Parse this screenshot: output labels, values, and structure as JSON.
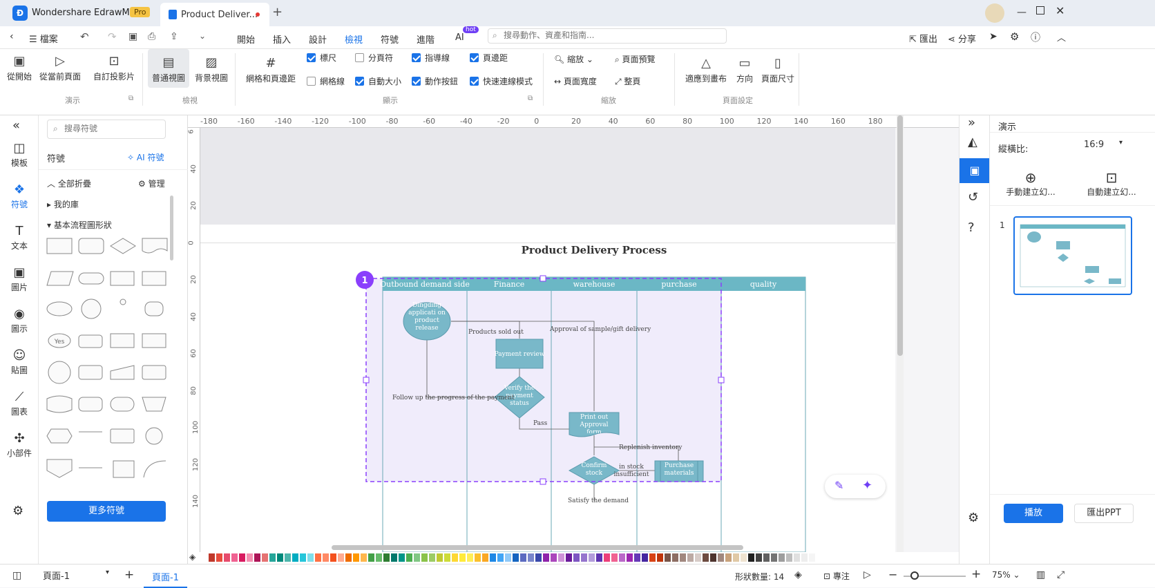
{
  "titlebar": {
    "app_name": "Wondershare EdrawMax",
    "pro_badge": "Pro",
    "doc_tab": "Product Deliver...",
    "new_tab": "+"
  },
  "menubar": {
    "file": "檔案",
    "tabs": [
      "開始",
      "插入",
      "設計",
      "檢視",
      "符號",
      "進階",
      "AI"
    ],
    "active_tab": "檢視",
    "ai_badge": "hot",
    "search_placeholder": "搜尋動作、資產和指南...",
    "export": "匯出",
    "share": "分享"
  },
  "ribbon": {
    "present": {
      "items": [
        "從開始",
        "從當前頁面",
        "自訂投影片"
      ],
      "label": "演示"
    },
    "view": {
      "items": [
        "普通視圖",
        "背景視圖"
      ],
      "label": "檢視"
    },
    "grid_btn": "網格和頁邊距",
    "display": {
      "checks": [
        {
          "label": "標尺",
          "on": true
        },
        {
          "label": "分頁符",
          "on": false
        },
        {
          "label": "指導線",
          "on": true
        },
        {
          "label": "頁邊距",
          "on": true
        },
        {
          "label": "網格線",
          "on": false
        },
        {
          "label": "自動大小",
          "on": true
        },
        {
          "label": "動作按鈕",
          "on": true
        },
        {
          "label": "快速連線模式",
          "on": true
        }
      ],
      "label": "顯示"
    },
    "zoom": {
      "items": [
        "縮放",
        "頁面預覽",
        "頁面寬度",
        "整頁"
      ],
      "label": "縮放"
    },
    "page_setup": {
      "items": [
        "適應到畫布",
        "方向",
        "頁面尺寸"
      ],
      "label": "頁面設定"
    }
  },
  "leftnav": {
    "items": [
      "模板",
      "符號",
      "文本",
      "圖片",
      "圖示",
      "貼圖",
      "圖表",
      "小部件"
    ]
  },
  "library": {
    "search_placeholder": "搜尋符號",
    "title": "符號",
    "ai_symbol": "AI 符號",
    "collapse_all": "全部折疊",
    "manage": "管理",
    "my_library": "我的庫",
    "basic_flow": "基本流程圖形狀",
    "more_symbols": "更多符號",
    "yes_label": "Yes"
  },
  "ruler": {
    "h": [
      "-180",
      "-160",
      "-140",
      "-120",
      "-100",
      "-80",
      "-60",
      "-40",
      "-20",
      "0",
      "20",
      "40",
      "60",
      "80",
      "100",
      "120",
      "140",
      "160",
      "180"
    ],
    "v": [
      "6",
      "40",
      "20",
      "0",
      "20",
      "40",
      "60",
      "80",
      "100",
      "120",
      "140"
    ]
  },
  "diagram": {
    "title": "Product Delivery Process",
    "lanes": [
      "Outbound demand side",
      "Finance",
      "warehouse",
      "purchase",
      "quality"
    ],
    "badge": "1",
    "nodes": {
      "dingding": "Dingding applicati on product release",
      "payment_review": "Payment review",
      "verify": "Verify the payment status",
      "print_out": "Print out Approval form",
      "confirm_stock": "Confirm stock",
      "purchase": "Purchase materials"
    },
    "labels": {
      "products_sold": "Products sold out",
      "approval": "Approval of sample/gift delivery",
      "follow_up": "Follow up the progress of the payment",
      "pass": "Pass",
      "replenish": "Replenish inventory",
      "in_stock": "in stock insufficient",
      "satisfy": "Satisfy the demand"
    }
  },
  "rightpanel": {
    "title": "演示",
    "ratio_label": "縱橫比:",
    "ratio_value": "16:9",
    "manual": "手動建立幻...",
    "auto": "自動建立幻...",
    "slide_no": "1",
    "play": "播放",
    "export_ppt": "匯出PPT"
  },
  "statusbar": {
    "page_select": "頁面-1",
    "page_tab": "頁面-1",
    "shape_count": "形狀數量: 14",
    "focus": "專注",
    "zoom": "75%"
  },
  "colors": {
    "accent": "#1a73e8",
    "lane_header": "#6bb7c5",
    "node": "#79b8c9",
    "selection": "#8a3ffc"
  },
  "palette": [
    "#c0392b",
    "#e74c3c",
    "#e74c6c",
    "#f06292",
    "#d81b60",
    "#f48fb1",
    "#ad1457",
    "#e57373",
    "#26a69a",
    "#00897b",
    "#4db6ac",
    "#00acc1",
    "#26c6da",
    "#80deea",
    "#ff7043",
    "#ff8a65",
    "#f4511e",
    "#ffab91",
    "#ef6c00",
    "#ff9800",
    "#ffb74d",
    "#43a047",
    "#66bb6a",
    "#2e7d32",
    "#00796b",
    "#009688",
    "#4caf50",
    "#81c784",
    "#8bc34a",
    "#9ccc65",
    "#c0ca33",
    "#cddc39",
    "#fdd835",
    "#ffeb3b",
    "#ffee58",
    "#fbc02d",
    "#f9a825",
    "#1e88e5",
    "#42a5f5",
    "#90caf9",
    "#1565c0",
    "#5c6bc0",
    "#7986cb",
    "#3949ab",
    "#8e24aa",
    "#ab47bc",
    "#ce93d8",
    "#6a1b9a",
    "#7e57c2",
    "#9575cd",
    "#b39ddb",
    "#5e35b1",
    "#ec407a",
    "#f06292",
    "#ba68c8",
    "#9c27b0",
    "#673ab7",
    "#4527a0",
    "#d84315",
    "#bf360c",
    "#795548",
    "#8d6e63",
    "#a1887f",
    "#bcaaa4",
    "#d7ccc8",
    "#6d4c41",
    "#4e342e",
    "#a1887f",
    "#c8a27c",
    "#e0c9a6",
    "#efe3d0",
    "#212121",
    "#424242",
    "#616161",
    "#757575",
    "#9e9e9e",
    "#bdbdbd",
    "#e0e0e0",
    "#eeeeee",
    "#f5f5f5"
  ]
}
